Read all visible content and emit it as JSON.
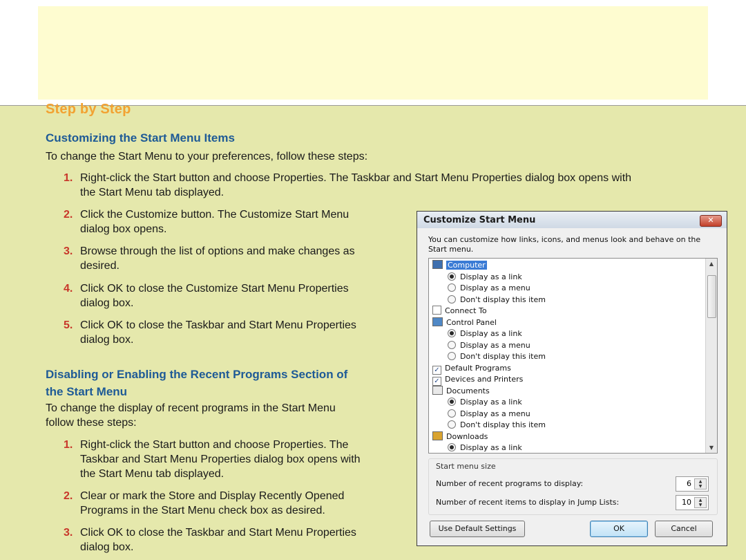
{
  "heading": "Step by Step",
  "section1": {
    "title": "Customizing the Start Menu Items",
    "intro": "To change the Start Menu to your preferences, follow these steps:",
    "steps": [
      {
        "n": "1.",
        "lines": [
          "Right-click the Start button and choose Properties. The Taskbar and Start Menu Properties dialog box opens with",
          "the Start Menu tab displayed."
        ]
      },
      {
        "n": "2.",
        "lines": [
          "Click the Customize button. The Customize Start Menu",
          "dialog box opens."
        ]
      },
      {
        "n": "3.",
        "lines": [
          "Browse through the list of options and make changes as",
          "desired."
        ]
      },
      {
        "n": "4.",
        "lines": [
          "Click OK to close the Customize Start Menu Properties",
          "dialog box."
        ]
      },
      {
        "n": "5.",
        "lines": [
          "Click OK to close the Taskbar and Start Menu Properties",
          "dialog box."
        ]
      }
    ]
  },
  "section2": {
    "title_lines": [
      "Disabling or Enabling the Recent Programs Section of",
      "the Start Menu"
    ],
    "intro_lines": [
      "To change the display of recent programs in the Start Menu",
      "follow these steps:"
    ],
    "steps": [
      {
        "n": "1.",
        "lines": [
          "Right-click the Start button and choose Properties. The",
          "Taskbar and Start Menu Properties dialog box opens with",
          "the Start Menu tab displayed."
        ]
      },
      {
        "n": "2.",
        "lines": [
          "Clear or mark the Store and Display Recently Opened",
          "Programs in the Start Menu check box as desired."
        ]
      },
      {
        "n": "3.",
        "lines": [
          "Click OK to close the Taskbar and Start Menu Properties",
          "dialog box."
        ]
      }
    ]
  },
  "dialog": {
    "title": "Customize Start Menu",
    "close_glyph": "✕",
    "intro": "You can customize how links, icons, and menus look and behave on the Start menu.",
    "items": [
      {
        "type": "header",
        "icon": "computer-icon",
        "label": "Computer",
        "selected": true
      },
      {
        "type": "radio",
        "label": "Display as a link",
        "checked": true
      },
      {
        "type": "radio",
        "label": "Display as a menu",
        "checked": false
      },
      {
        "type": "radio",
        "label": "Don't display this item",
        "checked": false
      },
      {
        "type": "check",
        "label": "Connect To",
        "checked": false
      },
      {
        "type": "header",
        "icon": "control-panel-icon",
        "label": "Control Panel",
        "selected": false
      },
      {
        "type": "radio",
        "label": "Display as a link",
        "checked": true
      },
      {
        "type": "radio",
        "label": "Display as a menu",
        "checked": false
      },
      {
        "type": "radio",
        "label": "Don't display this item",
        "checked": false
      },
      {
        "type": "check",
        "label": "Default Programs",
        "checked": true
      },
      {
        "type": "check",
        "label": "Devices and Printers",
        "checked": true
      },
      {
        "type": "header",
        "icon": "documents-icon",
        "label": "Documents",
        "selected": false
      },
      {
        "type": "radio",
        "label": "Display as a link",
        "checked": true
      },
      {
        "type": "radio",
        "label": "Display as a menu",
        "checked": false
      },
      {
        "type": "radio",
        "label": "Don't display this item",
        "checked": false
      },
      {
        "type": "header",
        "icon": "downloads-icon",
        "label": "Downloads",
        "selected": false
      },
      {
        "type": "radio",
        "label": "Display as a link",
        "checked": true
      }
    ],
    "size_group": {
      "label": "Start menu size",
      "recent_programs_label": "Number of recent programs to display:",
      "recent_programs_value": "6",
      "jump_list_label": "Number of recent items to display in Jump Lists:",
      "jump_list_value": "10"
    },
    "buttons": {
      "defaults": "Use Default Settings",
      "ok": "OK",
      "cancel": "Cancel"
    }
  }
}
